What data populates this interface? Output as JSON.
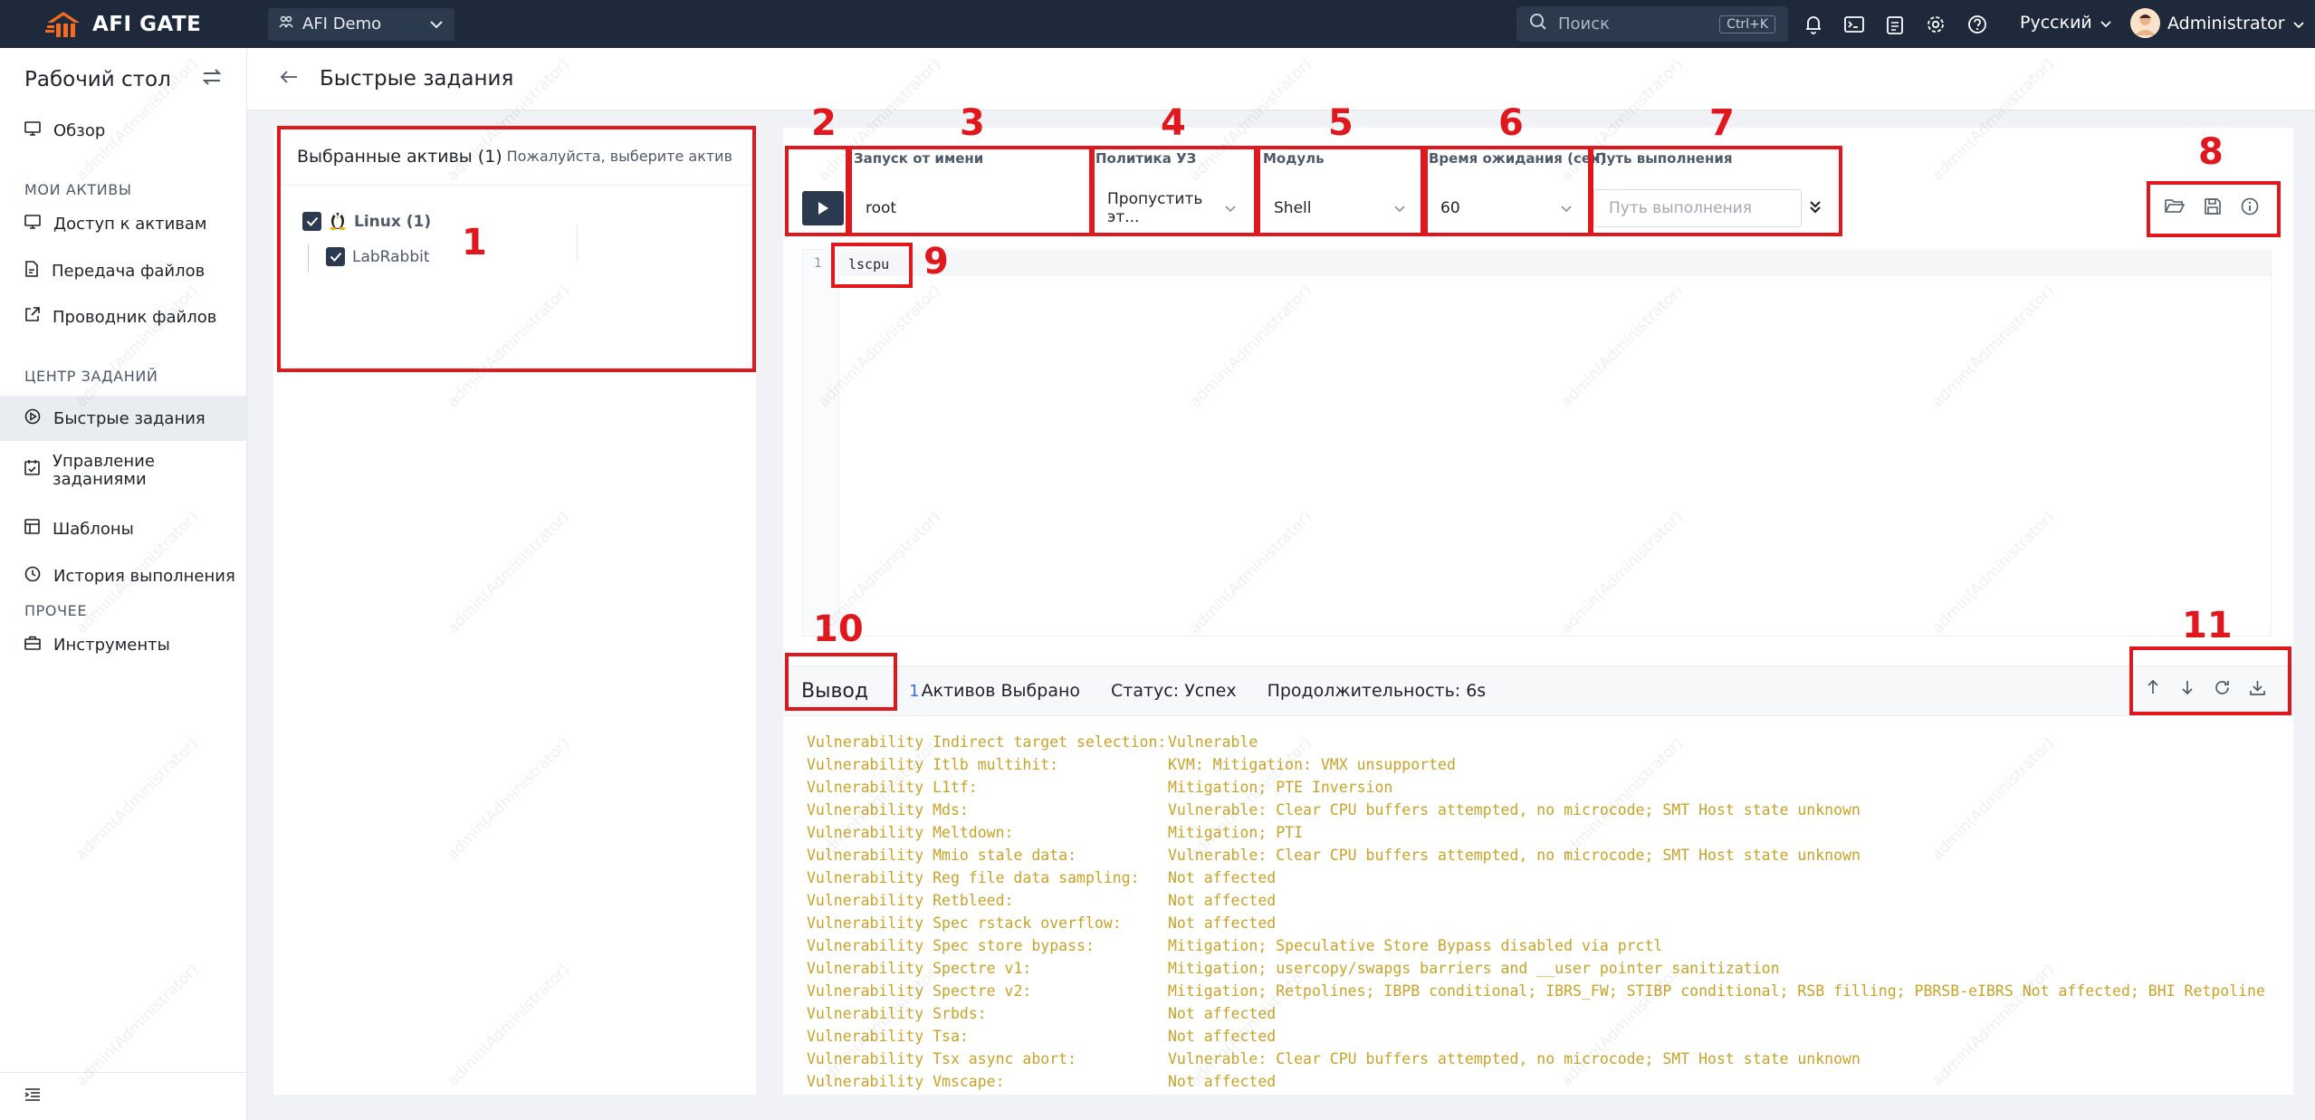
{
  "topbar": {
    "logo_text": "AFI GATE",
    "org": "AFI Demo",
    "search_placeholder": "Поиск",
    "search_shortcut": "Ctrl+K",
    "language": "Русский",
    "user": "Administrator"
  },
  "sidebar": {
    "title": "Рабочий стол",
    "items": {
      "overview": "Обзор",
      "section_assets": "МОИ АКТИВЫ",
      "asset_access": "Доступ к активам",
      "file_transfer": "Передача файлов",
      "file_explorer": "Проводник файлов",
      "section_tasks": "ЦЕНТР ЗАДАНИЙ",
      "quick_tasks": "Быстрые задания",
      "task_management": "Управление заданиями",
      "templates": "Шаблоны",
      "exec_history": "История выполнения",
      "section_other": "ПРОЧЕЕ",
      "tools": "Инструменты"
    }
  },
  "page": {
    "title": "Быстрые задания"
  },
  "assets": {
    "title": "Выбранные активы (1)",
    "hint": "Пожалуйста, выберите актив",
    "group": "Linux (1)",
    "host": "LabRabbit"
  },
  "form": {
    "run_as_label": "Запуск от имени",
    "run_as_value": "root",
    "policy_label": "Политика УЗ",
    "policy_value": "Пропустить эт...",
    "module_label": "Модуль",
    "module_value": "Shell",
    "timeout_label": "Время ожидания (сек)",
    "timeout_value": "60",
    "path_label": "Путь выполнения",
    "path_placeholder": "Путь выполнения"
  },
  "editor": {
    "line_number": "1",
    "code": "lscpu"
  },
  "output_bar": {
    "title": "Вывод",
    "selected_count": "1",
    "selected_label": "Активов Выбрано",
    "status": "Статус: Успех",
    "duration": "Продолжительность: 6s"
  },
  "output_lines": [
    [
      "Vulnerability Indirect target selection:",
      "Vulnerable"
    ],
    [
      "Vulnerability Itlb multihit:",
      "KVM: Mitigation: VMX unsupported"
    ],
    [
      "Vulnerability L1tf:",
      "Mitigation; PTE Inversion"
    ],
    [
      "Vulnerability Mds:",
      "Vulnerable: Clear CPU buffers attempted, no microcode; SMT Host state unknown"
    ],
    [
      "Vulnerability Meltdown:",
      "Mitigation; PTI"
    ],
    [
      "Vulnerability Mmio stale data:",
      "Vulnerable: Clear CPU buffers attempted, no microcode; SMT Host state unknown"
    ],
    [
      "Vulnerability Reg file data sampling:",
      "Not affected"
    ],
    [
      "Vulnerability Retbleed:",
      "Not affected"
    ],
    [
      "Vulnerability Spec rstack overflow:",
      "Not affected"
    ],
    [
      "Vulnerability Spec store bypass:",
      "Mitigation; Speculative Store Bypass disabled via prctl"
    ],
    [
      "Vulnerability Spectre v1:",
      "Mitigation; usercopy/swapgs barriers and __user pointer sanitization"
    ],
    [
      "Vulnerability Spectre v2:",
      "Mitigation; Retpolines; IBPB conditional; IBRS_FW; STIBP conditional; RSB filling; PBRSB-eIBRS Not affected; BHI Retpoline"
    ],
    [
      "Vulnerability Srbds:",
      "Not affected"
    ],
    [
      "Vulnerability Tsa:",
      "Not affected"
    ],
    [
      "Vulnerability Tsx async abort:",
      "Vulnerable: Clear CPU buffers attempted, no microcode; SMT Host state unknown"
    ],
    [
      "Vulnerability Vmscape:",
      "Not affected"
    ]
  ],
  "annotations": [
    "1",
    "2",
    "3",
    "4",
    "5",
    "6",
    "7",
    "8",
    "9",
    "10",
    "11"
  ],
  "watermark": "admin(Administrator)",
  "colors": {
    "topbar": "#1e2a3b",
    "accent_orange": "#f26b21",
    "annotation_red": "#e0171d",
    "output_text": "#c9a227",
    "button_dark": "#2b3a4e"
  }
}
